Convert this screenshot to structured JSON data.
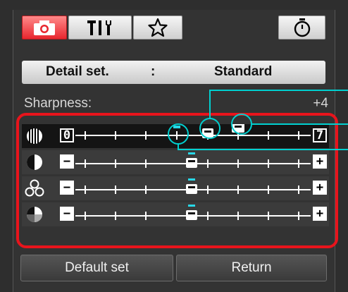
{
  "tabs": [
    {
      "icon": "camera-icon",
      "active": true
    },
    {
      "icon": "tools-icon",
      "active": false
    },
    {
      "icon": "star-icon",
      "active": false
    },
    {
      "icon": "timer-icon",
      "active": false
    }
  ],
  "detail_set": {
    "label": "Detail set.",
    "separator": ":",
    "value": "Standard"
  },
  "sharpness": {
    "label": "Sharpness:",
    "value": "+4"
  },
  "sliders": [
    {
      "icon": "sharpness-icon",
      "min_label": "0",
      "max_label": "7",
      "selected": true
    },
    {
      "icon": "contrast-icon",
      "min_label": "−",
      "max_label": "+",
      "selected": false
    },
    {
      "icon": "color-saturation-icon",
      "min_label": "−",
      "max_label": "+",
      "selected": false
    },
    {
      "icon": "color-tone-icon",
      "min_label": "−",
      "max_label": "+",
      "selected": false
    }
  ],
  "buttons": {
    "default_set": "Default set",
    "return": "Return"
  },
  "colors": {
    "highlight": "#e8141c",
    "callout": "#00d0d0",
    "accent_tab": "#e8262e"
  }
}
